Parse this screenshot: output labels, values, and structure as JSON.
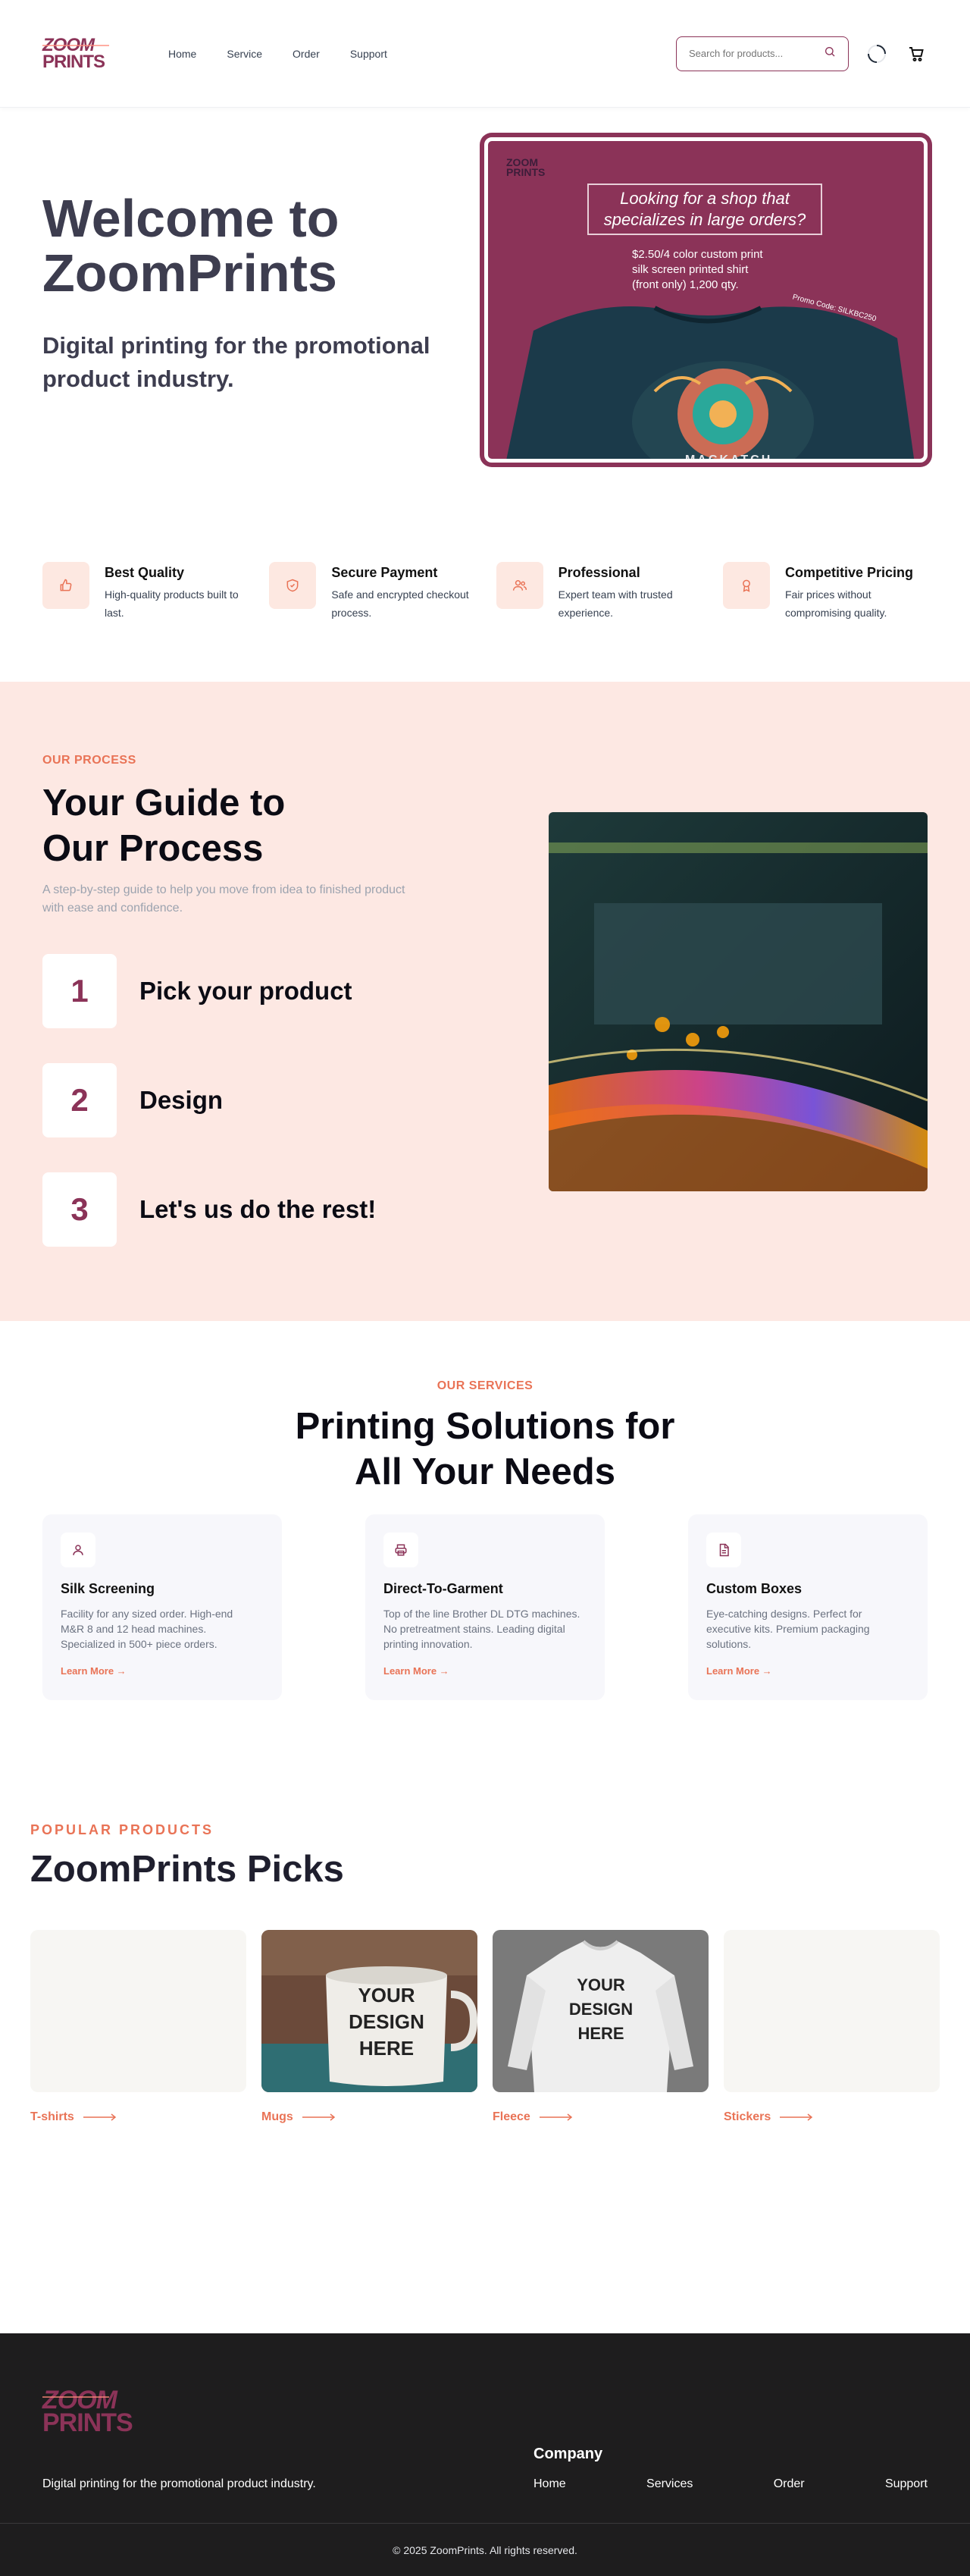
{
  "header": {
    "logo": {
      "top": "ZOOM",
      "bottom": "PRINTS"
    },
    "nav": [
      "Home",
      "Service",
      "Order",
      "Support"
    ],
    "search_placeholder": "Search for products..."
  },
  "hero": {
    "title_line1": "Welcome to",
    "title_line2": "ZoomPrints",
    "subtitle": "Digital printing for the promotional product industry.",
    "promo": {
      "headline": "Looking for a shop that specializes in large orders?",
      "line1": "$2.50/4 color custom print",
      "line2": "silk screen printed shirt",
      "line3": "(front only) 1,200 qty.",
      "code": "Promo Code: SILKBC250",
      "shirt_text": "MACKATCH COLLECTION"
    }
  },
  "features": [
    {
      "icon": "thumbs-up-icon",
      "title": "Best Quality",
      "desc": "High-quality products built to last."
    },
    {
      "icon": "shield-icon",
      "title": "Secure Payment",
      "desc": "Safe and encrypted checkout process."
    },
    {
      "icon": "users-icon",
      "title": "Professional",
      "desc": "Expert team with trusted experience."
    },
    {
      "icon": "award-icon",
      "title": "Competitive Pricing",
      "desc": "Fair prices without compromising quality."
    }
  ],
  "process": {
    "eyebrow": "OUR PROCESS",
    "title_line1": "Your Guide to",
    "title_line2": "Our Process",
    "desc": "A step-by-step guide to help you move from idea to finished product with ease and confidence.",
    "steps": [
      {
        "num": "1",
        "label": "Pick your product"
      },
      {
        "num": "2",
        "label": "Design"
      },
      {
        "num": "3",
        "label": "Let's us do the rest!"
      }
    ]
  },
  "services": {
    "eyebrow": "OUR SERVICES",
    "title_line1": "Printing Solutions for",
    "title_line2": "All Your Needs",
    "cards": [
      {
        "icon": "person-icon",
        "name": "Silk Screening",
        "desc": "Facility for any sized order. High-end M&R 8 and 12 head machines. Specialized in 500+ piece orders.",
        "link": "Learn More →"
      },
      {
        "icon": "printer-icon",
        "name": "Direct-To-Garment",
        "desc": "Top of the line Brother DL DTG machines. No pretreatment stains. Leading digital printing innovation.",
        "link": "Learn More →"
      },
      {
        "icon": "document-icon",
        "name": "Custom Boxes",
        "desc": "Eye-catching designs. Perfect for executive kits. Premium packaging solutions.",
        "link": "Learn More →"
      }
    ]
  },
  "products": {
    "eyebrow": "POPULAR PRODUCTS",
    "title": "ZoomPrints Picks",
    "items": [
      {
        "label": "T-shirts",
        "image_text": ""
      },
      {
        "label": "Mugs",
        "image_text": "YOUR DESIGN HERE"
      },
      {
        "label": "Fleece",
        "image_text": "YOUR DESIGN HERE"
      },
      {
        "label": "Stickers",
        "image_text": ""
      }
    ]
  },
  "footer": {
    "tagline": "Digital printing for the promotional product industry.",
    "company_heading": "Company",
    "nav": [
      "Home",
      "Services",
      "Order",
      "Support"
    ],
    "copyright": "© 2025 ZoomPrints. All rights reserved."
  }
}
